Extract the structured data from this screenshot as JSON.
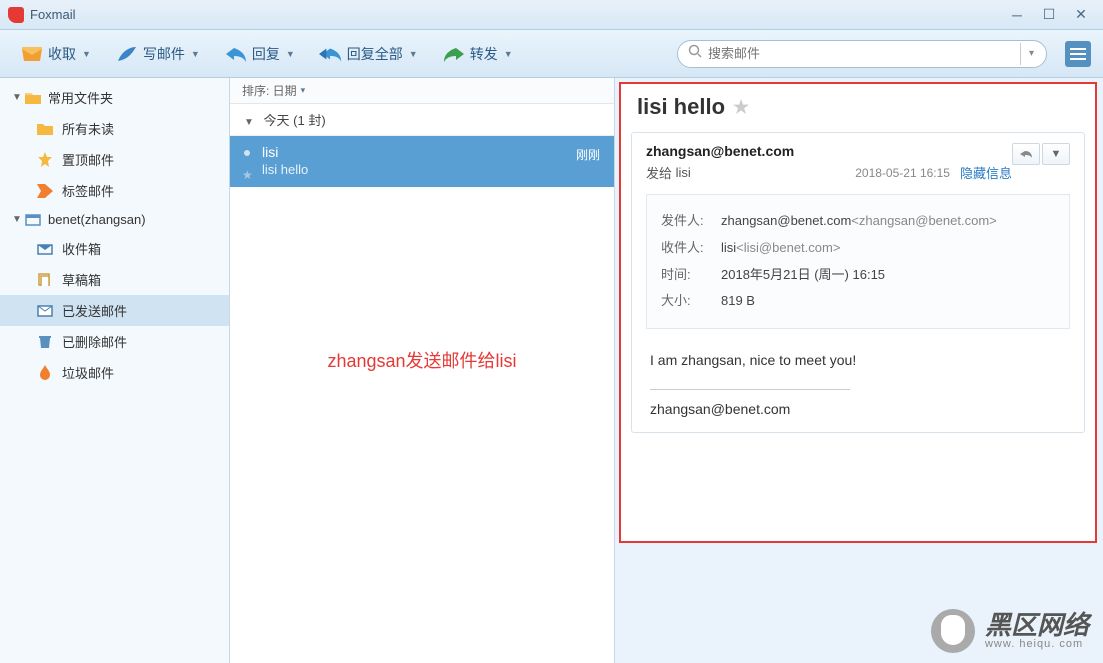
{
  "window": {
    "title": "Foxmail"
  },
  "toolbar": {
    "receive": "收取",
    "compose": "写邮件",
    "reply": "回复",
    "reply_all": "回复全部",
    "forward": "转发",
    "search_placeholder": "搜索邮件"
  },
  "sidebar": {
    "common": {
      "label": "常用文件夹",
      "items": [
        {
          "label": "所有未读",
          "icon": "folder"
        },
        {
          "label": "置顶邮件",
          "icon": "star"
        },
        {
          "label": "标签邮件",
          "icon": "tag"
        }
      ]
    },
    "account": {
      "label": "benet(zhangsan)",
      "items": [
        {
          "label": "收件箱",
          "icon": "inbox"
        },
        {
          "label": "草稿箱",
          "icon": "draft"
        },
        {
          "label": "已发送邮件",
          "icon": "sent",
          "selected": true
        },
        {
          "label": "已删除邮件",
          "icon": "trash"
        },
        {
          "label": "垃圾邮件",
          "icon": "spam"
        }
      ]
    }
  },
  "list": {
    "sort_label": "排序: 日期",
    "group_label": "今天 (1 封)",
    "message": {
      "sender": "lisi",
      "subject": "lisi hello",
      "time": "刚刚"
    },
    "annotation": "zhangsan发送邮件给lisi"
  },
  "reading": {
    "subject": "lisi hello",
    "from": "zhangsan@benet.com",
    "to_label": "发给",
    "to_name": "lisi",
    "date": "2018-05-21 16:15",
    "hide_info": "隐藏信息",
    "details": {
      "sender_label": "发件人:",
      "sender_name": "zhangsan@benet.com",
      "sender_email": "<zhangsan@benet.com>",
      "recipient_label": "收件人:",
      "recipient_name": "lisi",
      "recipient_email": "<lisi@benet.com>",
      "time_label": "时间:",
      "time_value": "2018年5月21日 (周一) 16:15",
      "size_label": "大小:",
      "size_value": "819 B"
    },
    "body": "I am zhangsan, nice to meet you!",
    "signature": "zhangsan@benet.com"
  },
  "watermark": {
    "main": "黑区网络",
    "sub": "www. heiqu. com"
  }
}
